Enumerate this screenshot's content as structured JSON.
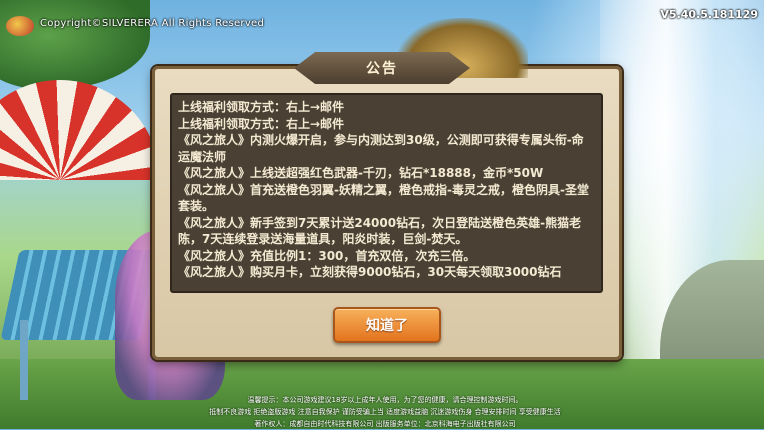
{
  "copyright": "Copyright©SILVERERA All Rights Reserved",
  "version": "V5.40.5.181129",
  "dialog": {
    "title": "公告",
    "lines": [
      "上线福利领取方式：右上→邮件",
      "上线福利领取方式：右上→邮件",
      "《风之旅人》内测火爆开启，参与内测达到30级，公测即可获得专属头衔-命运魔法师",
      "《风之旅人》上线送超强红色武器-千刃，钻石*18888，金币*50W",
      "《风之旅人》首充送橙色羽翼-妖精之翼，橙色戒指-毒灵之戒，橙色阴具-圣堂套装。",
      "《风之旅人》新手签到7天累计送24000钻石，次日登陆送橙色英雄-熊猫老陈，7天连续登录送海量道具，阳炎时装，巨剑-焚天。",
      "《风之旅人》充值比例1：300，首充双倍，次充三倍。",
      "《风之旅人》购买月卡，立刻获得9000钻石，30天每天领取3000钻石"
    ],
    "confirm_label": "知道了"
  },
  "footer": {
    "line1": "温馨提示：本公司游戏建议18岁以上成年人使用，为了您的健康，请合理控制游戏时间。",
    "line2": "抵制不良游戏  拒绝盗版游戏  注意自我保护  谨防受骗上当  适度游戏益脑  沉迷游戏伤身  合理安排时间  享受健康生活",
    "line3": "著作权人：成都自由时代科技有限公司  出版服务单位：北京科海电子出版社有限公司"
  }
}
